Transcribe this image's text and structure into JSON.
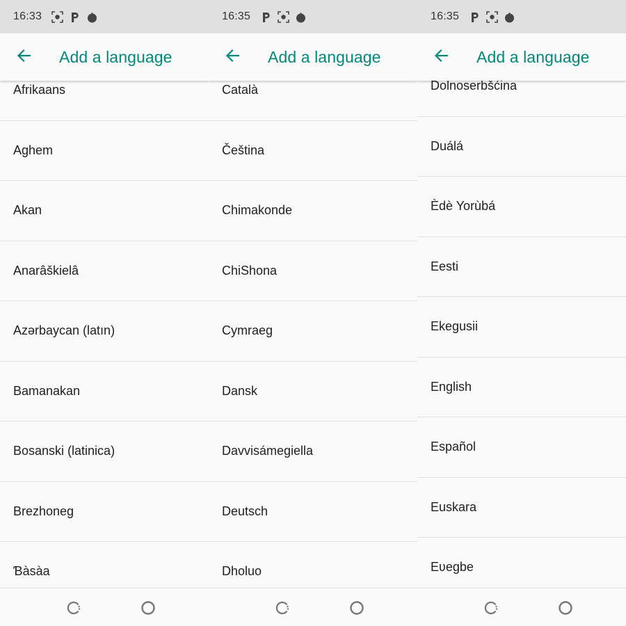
{
  "screens": [
    {
      "time": "16:33",
      "status_icons": [
        "screenshot-icon",
        "p-app-icon",
        "fire-app-icon"
      ],
      "title": "Add a language",
      "back_icon": "arrow-back-icon",
      "items": [
        "Afrikaans",
        "Aghem",
        "Akan",
        "Anarâškielâ",
        "Azərbaycan (latın)",
        "Bamanakan",
        "Bosanski (latinica)",
        "Brezhoneg",
        "Ɓàsàa"
      ]
    },
    {
      "time": "16:35",
      "status_icons": [
        "p-app-icon",
        "screenshot-icon",
        "fire-app-icon"
      ],
      "title": "Add a language",
      "back_icon": "arrow-back-icon",
      "items": [
        "Català",
        "Čeština",
        "Chimakonde",
        "ChiShona",
        "Cymraeg",
        "Dansk",
        "Davvisámegiella",
        "Deutsch",
        "Dholuo"
      ]
    },
    {
      "time": "16:35",
      "status_icons": [
        "p-app-icon",
        "screenshot-icon",
        "fire-app-icon"
      ],
      "title": "Add a language",
      "back_icon": "arrow-back-icon",
      "items": [
        "Dolnoserbšćina",
        "Duálá",
        "Èdè Yorùbá",
        "Eesti",
        "Ekegusii",
        "English",
        "Español",
        "Euskara",
        "Eʋegbe"
      ]
    }
  ],
  "colors": {
    "accent": "#00897b",
    "status_bar": "#e0e0e0",
    "background": "#fafafa",
    "divider": "#e0e0e0",
    "text": "#212121"
  },
  "nav_icons": [
    "recents-icon",
    "home-icon"
  ]
}
